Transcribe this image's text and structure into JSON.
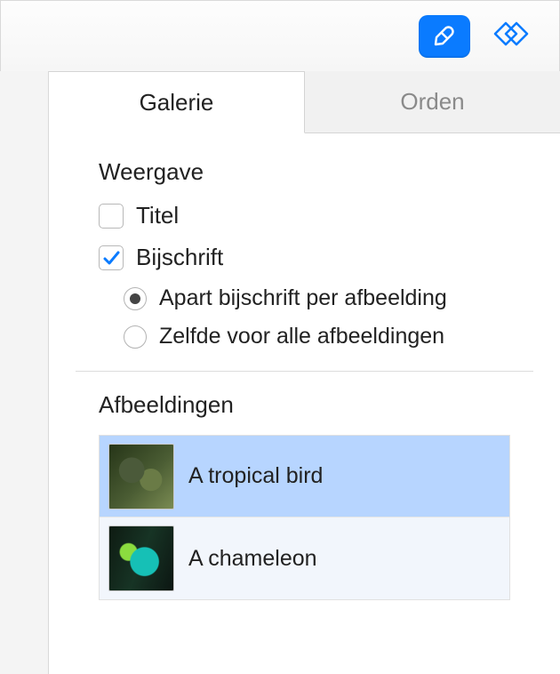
{
  "toolbar": {
    "format_icon": "format-brush-icon",
    "document_icon": "document-shape-icon"
  },
  "tabs": {
    "gallery": "Galerie",
    "order": "Orden",
    "active": "gallery"
  },
  "display": {
    "heading": "Weergave",
    "title": {
      "label": "Titel",
      "checked": false
    },
    "caption": {
      "label": "Bijschrift",
      "checked": true,
      "mode": "per_image",
      "options": {
        "per_image": "Apart bijschrift per afbeelding",
        "same_all": "Zelfde voor alle afbeeldingen"
      }
    }
  },
  "images": {
    "heading": "Afbeeldingen",
    "selected_index": 0,
    "items": [
      {
        "caption": "A tropical bird",
        "thumb": "parrot"
      },
      {
        "caption": "A chameleon",
        "thumb": "chameleon"
      }
    ]
  },
  "colors": {
    "accent": "#0a7bff",
    "selection": "#b7d5ff"
  }
}
